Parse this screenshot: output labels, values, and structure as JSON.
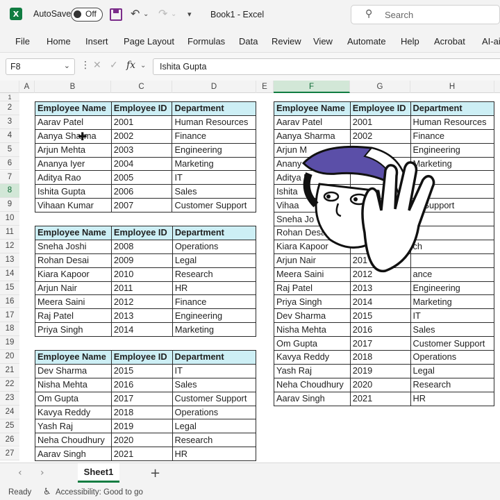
{
  "titlebar": {
    "autosave_label": "AutoSave",
    "autosave_state": "Off",
    "doc_title": "Book1  -  Excel",
    "search_placeholder": "Search"
  },
  "ribbon": {
    "tabs": [
      "File",
      "Home",
      "Insert",
      "Page Layout",
      "Formulas",
      "Data",
      "Review",
      "View",
      "Automate",
      "Help",
      "Acrobat",
      "AI-ai"
    ]
  },
  "formula_bar": {
    "name_box": "F8",
    "fx": "fx",
    "formula": "Ishita Gupta"
  },
  "columns": [
    "A",
    "B",
    "C",
    "D",
    "E",
    "F",
    "G",
    "H"
  ],
  "selected_column": "F",
  "rows": [
    "1",
    "2",
    "3",
    "4",
    "5",
    "6",
    "7",
    "8",
    "9",
    "10",
    "11",
    "12",
    "13",
    "14",
    "15",
    "16",
    "17",
    "18",
    "19",
    "20",
    "21",
    "22",
    "23",
    "24",
    "25",
    "26",
    "27"
  ],
  "selected_row": "8",
  "headers": [
    "Employee Name",
    "Employee ID",
    "Department"
  ],
  "table1": [
    [
      "Aarav Patel",
      "2001",
      "Human Resources"
    ],
    [
      "Aanya Sharma",
      "2002",
      "Finance"
    ],
    [
      "Arjun Mehta",
      "2003",
      "Engineering"
    ],
    [
      "Ananya Iyer",
      "2004",
      "Marketing"
    ],
    [
      "Aditya Rao",
      "2005",
      "IT"
    ],
    [
      "Ishita Gupta",
      "2006",
      "Sales"
    ],
    [
      "Vihaan Kumar",
      "2007",
      "Customer Support"
    ]
  ],
  "table2": [
    [
      "Sneha Joshi",
      "2008",
      "Operations"
    ],
    [
      "Rohan Desai",
      "2009",
      "Legal"
    ],
    [
      "Kiara Kapoor",
      "2010",
      "Research"
    ],
    [
      "Arjun Nair",
      "2011",
      "HR"
    ],
    [
      "Meera Saini",
      "2012",
      "Finance"
    ],
    [
      "Raj Patel",
      "2013",
      "Engineering"
    ],
    [
      "Priya Singh",
      "2014",
      "Marketing"
    ]
  ],
  "table3": [
    [
      "Dev Sharma",
      "2015",
      "IT"
    ],
    [
      "Nisha Mehta",
      "2016",
      "Sales"
    ],
    [
      "Om Gupta",
      "2017",
      "Customer Support"
    ],
    [
      "Kavya Reddy",
      "2018",
      "Operations"
    ],
    [
      "Yash Raj",
      "2019",
      "Legal"
    ],
    [
      "Neha Choudhury",
      "2020",
      "Research"
    ],
    [
      "Aarav Singh",
      "2021",
      "HR"
    ]
  ],
  "table_combined": [
    [
      "Aarav Patel",
      "2001",
      "Human Resources"
    ],
    [
      "Aanya Sharma",
      "2002",
      "Finance"
    ],
    [
      "Arjun M",
      "",
      "Engineering"
    ],
    [
      "Anany",
      "",
      "Marketing"
    ],
    [
      "Aditya R",
      "",
      ""
    ],
    [
      "Ishita",
      "",
      ""
    ],
    [
      "Vihaa",
      "",
      "er Support"
    ],
    [
      "Sneha Jo",
      "",
      "s"
    ],
    [
      "Rohan Desa",
      "",
      ""
    ],
    [
      "Kiara Kapoor",
      "",
      "ch"
    ],
    [
      "Arjun Nair",
      "201",
      ""
    ],
    [
      "Meera Saini",
      "2012",
      "ance"
    ],
    [
      "Raj Patel",
      "2013",
      "Engineering"
    ],
    [
      "Priya Singh",
      "2014",
      "Marketing"
    ],
    [
      "Dev Sharma",
      "2015",
      "IT"
    ],
    [
      "Nisha Mehta",
      "2016",
      "Sales"
    ],
    [
      "Om Gupta",
      "2017",
      "Customer Support"
    ],
    [
      "Kavya Reddy",
      "2018",
      "Operations"
    ],
    [
      "Yash Raj",
      "2019",
      "Legal"
    ],
    [
      "Neha Choudhury",
      "2020",
      "Research"
    ],
    [
      "Aarav Singh",
      "2021",
      "HR"
    ]
  ],
  "sheets": {
    "active": "Sheet1",
    "add": "+"
  },
  "status": {
    "ready": "Ready",
    "accessibility": "Accessibility: Good to go"
  },
  "colors": {
    "excel_green": "#107c41",
    "header_fill": "#cdeff5",
    "cap_purple": "#5b4fa8"
  }
}
